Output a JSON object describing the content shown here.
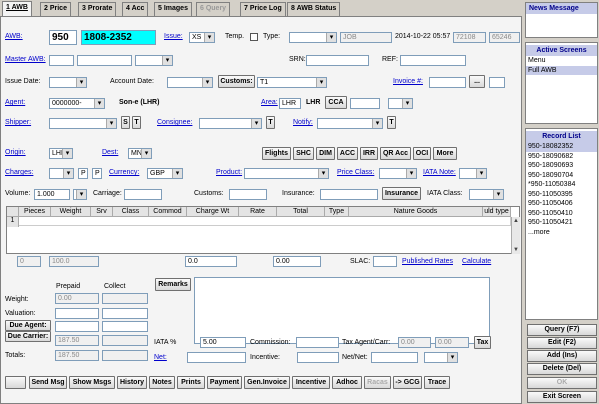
{
  "tabs": [
    "1 AWB",
    "2 Price",
    "3 Prorate",
    "4 Acc",
    "5 Images",
    "6 Query",
    "7 Price Log",
    "8 AWB Status"
  ],
  "awb": {
    "label": "AWB:",
    "prefix": "950",
    "number": "1808-2352",
    "issue_label": "Issue:",
    "issue": "XS",
    "temp_label": "Temp.",
    "type_label": "Type:",
    "job": "JOB",
    "datetime": "2014-10-22 05:57",
    "f1": "72108",
    "f2": "65246"
  },
  "row2": {
    "master_awb": "Master AWB:",
    "srn": "SRN:",
    "ref": "REF:"
  },
  "row3": {
    "issue_date": "Issue Date:",
    "account_date": "Account Date:",
    "customs_btn": "Customs:",
    "customs_val": "T1",
    "invoice": "Invoice #:",
    "dots": "..."
  },
  "row4": {
    "agent": "Agent:",
    "agent_code": "0000000-",
    "agent_name": "Son-e (LHR)",
    "area": "Area:",
    "area_code": "LHR",
    "area_text": "LHR",
    "cca": "CCA"
  },
  "row5": {
    "shipper": "Shipper:",
    "s": "S",
    "t": "T",
    "consignee": "Consignee:",
    "notify": "Notify:"
  },
  "row6": {
    "origin": "Origin:",
    "origin_val": "LHR",
    "dest": "Dest:",
    "dest_val": "MNL",
    "buttons": [
      "Flights",
      "SHC",
      "DIM",
      "ACC",
      "IRR",
      "QR Acc",
      "OCI",
      "More"
    ]
  },
  "row7": {
    "charges": "Charges:",
    "p1": "P",
    "p2": "P",
    "currency": "Currency:",
    "currency_val": "GBP",
    "product": "Product:",
    "price_class": "Price Class:",
    "iata_note": "IATA Note:"
  },
  "row8": {
    "volume": "Volume:",
    "volume_val": "1.000",
    "kg": "Kg",
    "carriage": "Carriage:",
    "customs": "Customs:",
    "insurance": "Insurance:",
    "insurance_btn": "Insurance",
    "iata_class": "IATA Class:"
  },
  "grid": {
    "headers": [
      "Pieces",
      "Weight",
      "Srv",
      "Class",
      "Commod",
      "Charge Wt",
      "Rate",
      "Total",
      "Type",
      "Nature Goods",
      "uld type"
    ],
    "row_num": "1"
  },
  "totals": {
    "pieces": "0",
    "weight": "100.0",
    "charge_wt": "0.0",
    "total": "0.00",
    "slac": "SLAC:",
    "published": "Published Rates",
    "calculate": "Calculate"
  },
  "bottom": {
    "prepaid": "Prepaid",
    "collect": "Collect",
    "remarks": "Remarks",
    "weight": "Weight:",
    "weight_pp": "0.00",
    "valuation": "Valuation:",
    "due_agent": "Due Agent:",
    "due_carrier": "Due Carrier:",
    "due_carrier_val": "187.50",
    "totals": "Totals:",
    "totals_val": "187.50",
    "iata_pct": "IATA %",
    "iata_val": "5.00",
    "commission": "Commission:",
    "tax_agent": "Tax Agent/Carr:",
    "tax1": "0.00",
    "tax2": "0.00",
    "tax_btn": "Tax",
    "net": "Net:",
    "incentive": "Incentive:",
    "netnet": "Net/Net:"
  },
  "toolbar": [
    "Send Msg",
    "Show Msgs",
    "History",
    "Notes",
    "Prints",
    "Payment",
    "Gen.Invoice",
    "Incentive",
    "Adhoc",
    "Racas",
    "-> GCG",
    "Trace"
  ],
  "side": {
    "news": "News Message",
    "active": "Active Screens",
    "active_items": [
      "Menu",
      "Full AWB"
    ],
    "records": "Record List",
    "record_items": [
      "950-18082352",
      "950-18090682",
      "950-18090693",
      "950-18090704",
      "*950-11050384",
      "950-11050395",
      "950-11050406",
      "950-11050410",
      "950-11050421",
      "...more"
    ],
    "buttons": [
      "Query (F7)",
      "Edit (F2)",
      "Add (Ins)",
      "Delete (Del)",
      "OK",
      "Exit Screen"
    ]
  }
}
